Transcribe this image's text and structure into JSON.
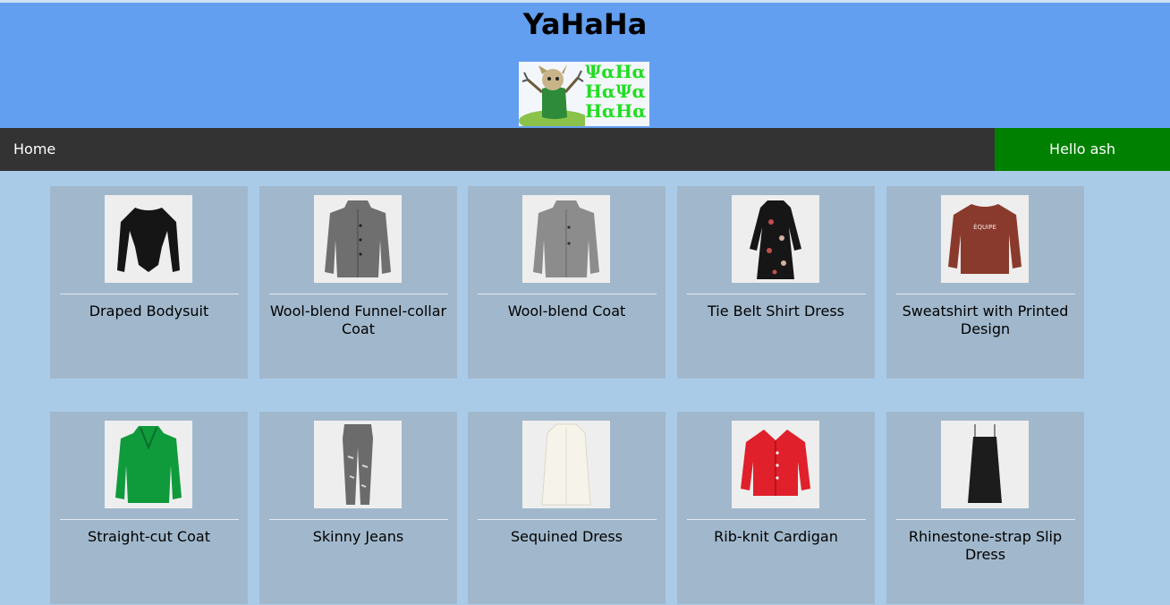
{
  "header": {
    "title": "YaHaHa",
    "logo_text": "ΨαHα\nHαΨα\nHαHα"
  },
  "nav": {
    "home": "Home",
    "greeting": "Hello ash"
  },
  "products": [
    {
      "name": "Draped Bodysuit"
    },
    {
      "name": "Wool-blend Funnel-collar Coat"
    },
    {
      "name": "Wool-blend Coat"
    },
    {
      "name": "Tie Belt Shirt Dress"
    },
    {
      "name": "Sweatshirt with Printed Design",
      "print": "ÉQUIPE"
    },
    {
      "name": "Straight-cut Coat"
    },
    {
      "name": "Skinny Jeans"
    },
    {
      "name": "Sequined Dress"
    },
    {
      "name": "Rib-knit Cardigan"
    },
    {
      "name": "Rhinestone-strap Slip Dress"
    }
  ],
  "colors": {
    "header_bg": "#639ff0",
    "nav_bg": "#333333",
    "greeting_bg": "#008000",
    "page_bg": "#aacbe7",
    "card_bg": "#a1b8cc"
  }
}
